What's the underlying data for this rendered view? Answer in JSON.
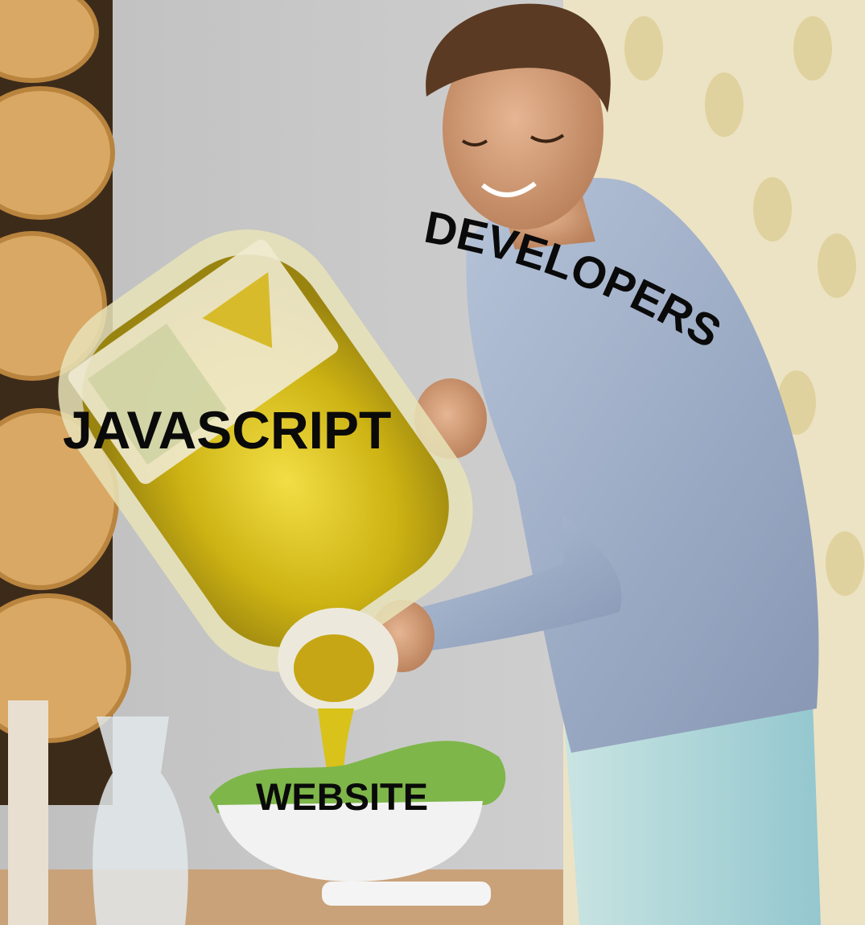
{
  "meme": {
    "captions": {
      "pourer": "DEVELOPERS",
      "bottle": "JAVASCRIPT",
      "bowl": "WEBSITE"
    }
  },
  "colors": {
    "oil": "#d9c21a",
    "shirt": "#9fb0c8",
    "pants": "#a9d3d6",
    "wallpaper": "#efe6c8",
    "wood": "#d9a864"
  }
}
